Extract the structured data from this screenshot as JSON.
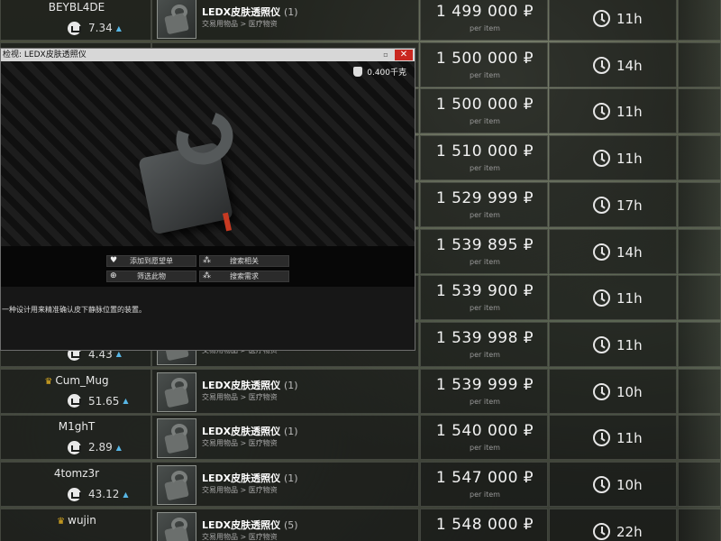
{
  "listings": [
    {
      "seller": "BEYBL4DE",
      "crown": false,
      "rating": "7.34",
      "item": "LEDX皮肤透照仪",
      "count": "(1)",
      "category": "交易用物品 > 医疗物资",
      "price": "1 499 000 ₽",
      "per_item": "per item",
      "time": "11h"
    },
    {
      "seller": "",
      "crown": false,
      "rating": "",
      "item": "",
      "count": "",
      "category": "",
      "price": "1 500 000 ₽",
      "per_item": "per item",
      "time": "14h"
    },
    {
      "seller": "",
      "crown": false,
      "rating": "",
      "item": "",
      "count": "",
      "category": "",
      "price": "1 500 000 ₽",
      "per_item": "per item",
      "time": "11h"
    },
    {
      "seller": "",
      "crown": false,
      "rating": "",
      "item": "",
      "count": "",
      "category": "",
      "price": "1 510 000 ₽",
      "per_item": "per item",
      "time": "11h"
    },
    {
      "seller": "",
      "crown": false,
      "rating": "",
      "item": "",
      "count": "",
      "category": "",
      "price": "1 529 999 ₽",
      "per_item": "per item",
      "time": "17h"
    },
    {
      "seller": "",
      "crown": false,
      "rating": "",
      "item": "",
      "count": "",
      "category": "",
      "price": "1 539 895 ₽",
      "per_item": "per item",
      "time": "14h"
    },
    {
      "seller": "",
      "crown": false,
      "rating": "",
      "item": "",
      "count": "",
      "category": "",
      "price": "1 539 900 ₽",
      "per_item": "per item",
      "time": "11h"
    },
    {
      "seller": "",
      "crown": false,
      "rating": "4.43",
      "item": "",
      "count": "",
      "category": "交易用物品 > 医疗物资",
      "price": "1 539 998 ₽",
      "per_item": "per item",
      "time": "11h"
    },
    {
      "seller": "Cum_Mug",
      "crown": true,
      "rating": "51.65",
      "item": "LEDX皮肤透照仪",
      "count": "(1)",
      "category": "交易用物品 > 医疗物资",
      "price": "1 539 999 ₽",
      "per_item": "per item",
      "time": "10h"
    },
    {
      "seller": "M1ghT",
      "crown": false,
      "rating": "2.89",
      "item": "LEDX皮肤透照仪",
      "count": "(1)",
      "category": "交易用物品 > 医疗物资",
      "price": "1 540 000 ₽",
      "per_item": "per item",
      "time": "11h"
    },
    {
      "seller": "4tomz3r",
      "crown": false,
      "rating": "43.12",
      "item": "LEDX皮肤透照仪",
      "count": "(1)",
      "category": "交易用物品 > 医疗物资",
      "price": "1 547 000 ₽",
      "per_item": "per item",
      "time": "10h"
    },
    {
      "seller": "wujin",
      "crown": true,
      "rating": "",
      "item": "LEDX皮肤透照仪",
      "count": "(5)",
      "category": "交易用物品 > 医疗物资",
      "price": "1 548 000 ₽",
      "per_item": "",
      "time": "22h"
    }
  ],
  "inspect": {
    "title": "检视: LEDX皮肤透照仪",
    "minimize": "▫",
    "close": "✕",
    "weight": "0.400千克",
    "actions": {
      "wishlist": "添加到愿望单",
      "search_related": "搜索相关",
      "filter": "筛选此物",
      "search_needed": "搜索需求"
    },
    "description": "一种设计用来精准确认皮下静脉位置的装置。"
  },
  "colors": {
    "close_red": "#c9271f",
    "crown_gold": "#e8b421",
    "rating_arrow": "#58b7e6"
  }
}
